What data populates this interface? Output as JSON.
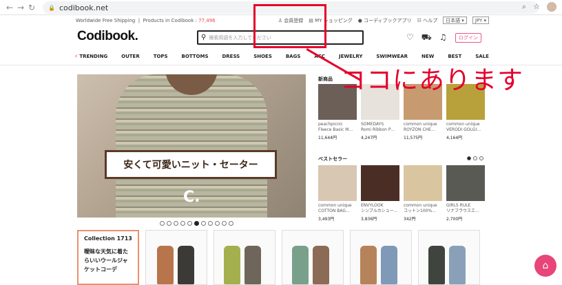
{
  "browser": {
    "url": "codibook.net",
    "back": "←",
    "forward": "→",
    "reload": "↻"
  },
  "topbar": {
    "shipping": "Worldwide Free Shipping",
    "products_label": "Products in Codibook :",
    "products_count": "77,496",
    "signup": "会員登録",
    "myshopping": "MY ショッピング",
    "app": "コーディブックアプリ",
    "help": "ヘルプ",
    "language": "日本語",
    "currency": "JPY"
  },
  "header": {
    "logo": "Codibook.",
    "search_placeholder": "検索用語を入力してください",
    "login": "ログイン"
  },
  "nav": [
    "TRENDING",
    "OUTER",
    "TOPS",
    "BOTTOMS",
    "DRESS",
    "SHOES",
    "BAGS",
    "ACC",
    "JEWELRY",
    "SWIMWEAR",
    "NEW",
    "BEST",
    "SALE"
  ],
  "hero": {
    "banner": "安くて可愛いニット・セーター",
    "logo_mark": "C."
  },
  "new_items": {
    "title": "新商品",
    "items": [
      {
        "brand": "peachpicnic",
        "name": "Fleece Basic M…",
        "price": "11,644円",
        "color": "#6b5f58"
      },
      {
        "brand": "SOMEDAYS",
        "name": "Romi Ribbon P…",
        "price": "4,247円",
        "color": "#e7e2dc"
      },
      {
        "brand": "common unique",
        "name": "ROYZON CHE…",
        "price": "11,575円",
        "color": "#c89a6f"
      },
      {
        "brand": "common unique",
        "name": "VERODI GOLGI…",
        "price": "4,164円",
        "color": "#b8a13a"
      }
    ]
  },
  "best_sellers": {
    "title": "ベストセラー",
    "items": [
      {
        "brand": "common unique",
        "name": "COTTON BAG…",
        "price": "3,493円",
        "color": "#d8c7b3"
      },
      {
        "brand": "ENVYLOOK",
        "name": "シンプルカシュー…",
        "price": "3,836円",
        "color": "#4a2e26"
      },
      {
        "brand": "common unique",
        "name": "コットン100%…",
        "price": "342円",
        "color": "#d9c6a0"
      },
      {
        "brand": "GIRLS RULE",
        "name": "リナブラウスエ…",
        "price": "2,700円",
        "color": "#5a5a55"
      }
    ]
  },
  "collection": {
    "title": "Collection 1713",
    "desc": "曖昧な天気に着たらいいウールジャケットコーデ"
  },
  "annotation": {
    "text": "ココにあります"
  },
  "fab_icon": "hanger-icon"
}
